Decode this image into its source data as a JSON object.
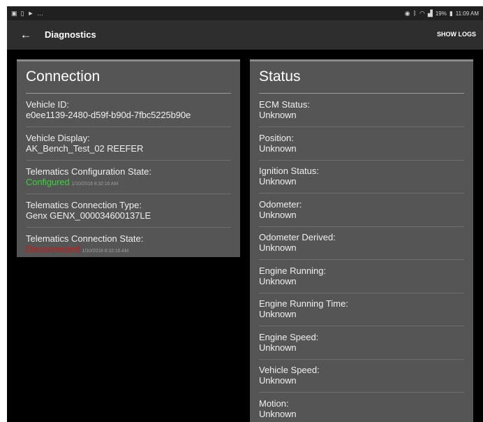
{
  "statusbar": {
    "left_icons": [
      "image-icon",
      "sim-icon",
      "play-icon",
      "more-icon"
    ],
    "right_text": "19%",
    "time": "11:09 AM"
  },
  "appbar": {
    "back_icon": "back-arrow-icon",
    "title": "Diagnostics",
    "action": "SHOW LOGS"
  },
  "connection": {
    "title": "Connection",
    "vehicle_id_label": "Vehicle ID:",
    "vehicle_id_value": "e0ee1139-2480-d59f-b90d-7fbc5225b90e",
    "vehicle_display_label": "Vehicle Display:",
    "vehicle_display_value": "AK_Bench_Test_02 REEFER",
    "config_state_label": "Telematics Configuration State:",
    "config_state_value": "Configured",
    "config_state_time": "1/10/2018 8:32:16 AM",
    "conn_type_label": "Telematics Connection Type:",
    "conn_type_value": "Genx GENX_000034600137LE",
    "conn_state_label": "Telematics Connection State:",
    "conn_state_value": "Disconnected",
    "conn_state_time": "1/10/2018 8:32:16 AM"
  },
  "status": {
    "title": "Status",
    "rows": [
      {
        "label": "ECM Status:",
        "value": "Unknown"
      },
      {
        "label": "Position:",
        "value": "Unknown"
      },
      {
        "label": "Ignition Status:",
        "value": "Unknown"
      },
      {
        "label": "Odometer:",
        "value": "Unknown"
      },
      {
        "label": "Odometer Derived:",
        "value": "Unknown"
      },
      {
        "label": "Engine Running:",
        "value": "Unknown"
      },
      {
        "label": "Engine Running Time:",
        "value": "Unknown"
      },
      {
        "label": "Engine Speed:",
        "value": "Unknown"
      },
      {
        "label": "Vehicle Speed:",
        "value": "Unknown"
      },
      {
        "label": "Motion:",
        "value": "Unknown"
      }
    ]
  },
  "colors": {
    "configured": "#3ad13a",
    "disconnected": "#d01818",
    "card": "#555555",
    "appbar": "#2e2e2e"
  }
}
